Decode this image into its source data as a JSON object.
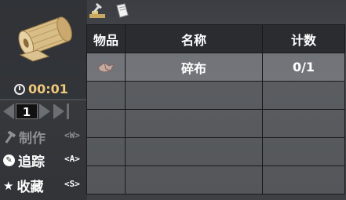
{
  "item_preview": {
    "icon": "cloth-roll-icon",
    "timer": "00:01"
  },
  "pager": {
    "page": "1"
  },
  "actions": [
    {
      "label": "制作",
      "key": "<W>",
      "icon": "hammer-icon",
      "enabled": false
    },
    {
      "label": "追踪",
      "key": "<A>",
      "icon": "track-icon",
      "enabled": true
    },
    {
      "label": "收藏",
      "key": "<S>",
      "icon": "star-icon",
      "enabled": true
    }
  ],
  "toolbar": {
    "icons": [
      "crafting-tools-icon",
      "book-icon"
    ]
  },
  "table": {
    "headers": {
      "item": "物品",
      "name": "名称",
      "count": "计数"
    },
    "rows": [
      {
        "icon": "cloth-scrap-icon",
        "name": "碎布",
        "count": "0/1"
      }
    ]
  },
  "colors": {
    "timer": "#f0c87a",
    "disabled_text": "#8d9094"
  }
}
